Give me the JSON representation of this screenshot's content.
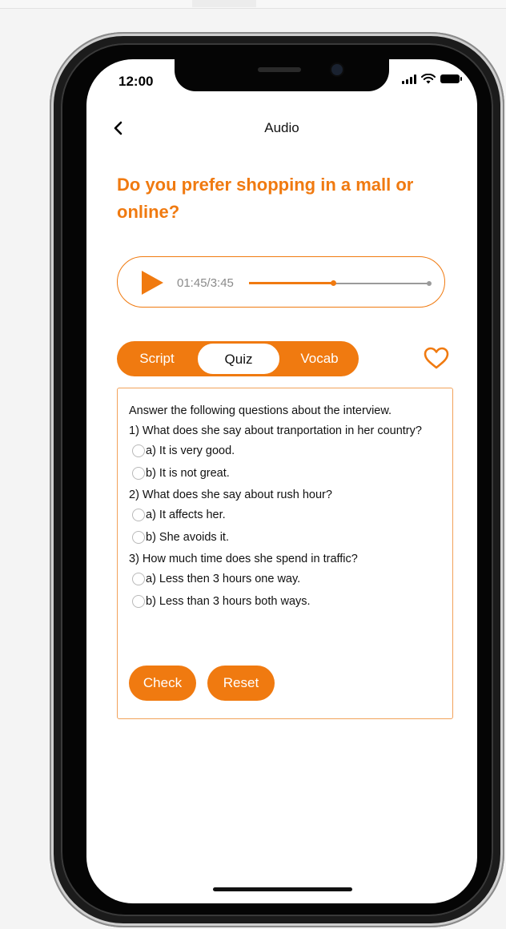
{
  "status_bar": {
    "time": "12:00"
  },
  "nav": {
    "title": "Audio",
    "back_icon": "chevron-left-icon"
  },
  "question": {
    "title": "Do you prefer shopping in a mall or online?"
  },
  "player": {
    "time_display": "01:45/3:45",
    "progress_fraction": 0.4667,
    "play_icon": "play-icon"
  },
  "tabs": [
    {
      "label": "Script",
      "active": false
    },
    {
      "label": "Quiz",
      "active": true
    },
    {
      "label": "Vocab",
      "active": false
    }
  ],
  "favorite_icon": "heart-outline-icon",
  "quiz": {
    "intro": "Answer the following questions about the interview.",
    "questions": [
      {
        "text": "1) What does she say about tranportation in her country?",
        "options": [
          "a) It is very good.",
          "b) It is not great."
        ]
      },
      {
        "text": "2) What does she say about rush hour?",
        "options": [
          "a) It affects her.",
          "b) She avoids it."
        ]
      },
      {
        "text": "3) How much time does she spend in traffic?",
        "options": [
          "a) Less then 3 hours one way.",
          "b) Less than 3 hours both ways."
        ]
      }
    ],
    "check_label": "Check",
    "reset_label": "Reset"
  },
  "colors": {
    "accent": "#f07a10",
    "border": "#f2a25a",
    "text": "#111111",
    "muted": "#8a8a8a"
  }
}
